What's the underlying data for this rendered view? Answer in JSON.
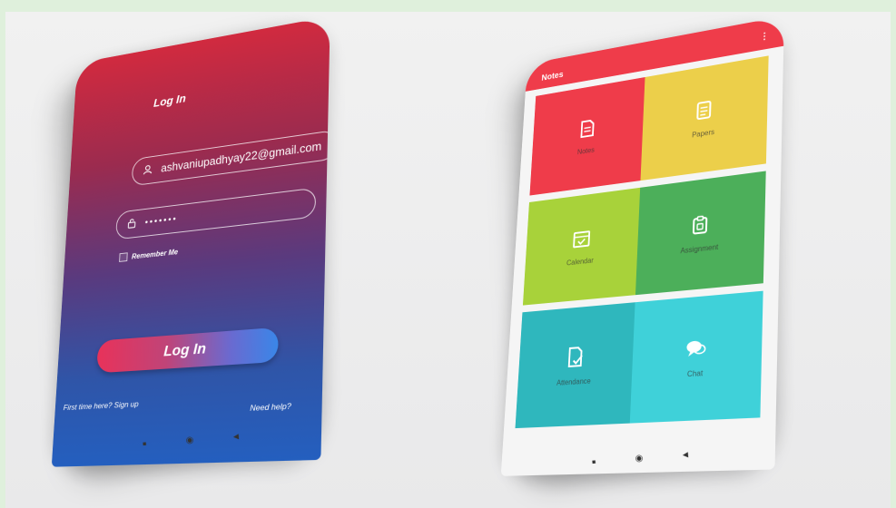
{
  "login_screen": {
    "title": "Log In",
    "email_value": "ashvaniupadhyay22@gmail.com",
    "password_value": "•••••••",
    "remember_label": "Remember Me",
    "login_button": "Log In",
    "signup_link": "First time here? Sign up",
    "help_link": "Need help?",
    "icons": {
      "email": "user-icon",
      "password": "lock-icon"
    },
    "colors": {
      "gradient_top": "#d12a3f",
      "gradient_bottom": "#245fbf",
      "button_left": "#e8325a",
      "button_right": "#3a86e8"
    }
  },
  "notes_screen": {
    "appbar_title": "Notes",
    "appbar_menu": "⋮",
    "tiles": [
      {
        "label": "Notes",
        "icon": "document-icon",
        "color": "#ef3c4a"
      },
      {
        "label": "Papers",
        "icon": "paper-icon",
        "color": "#eccf4a"
      },
      {
        "label": "Calendar",
        "icon": "calendar-icon",
        "color": "#a8d23a"
      },
      {
        "label": "Assignment",
        "icon": "clipboard-icon",
        "color": "#4caf5a"
      },
      {
        "label": "Attendance",
        "icon": "checklist-icon",
        "color": "#2fb7bd"
      },
      {
        "label": "Chat",
        "icon": "chat-icon",
        "color": "#3fd1d9"
      }
    ]
  },
  "nav_buttons": {
    "recent": "■",
    "home": "◉",
    "back": "◀"
  }
}
